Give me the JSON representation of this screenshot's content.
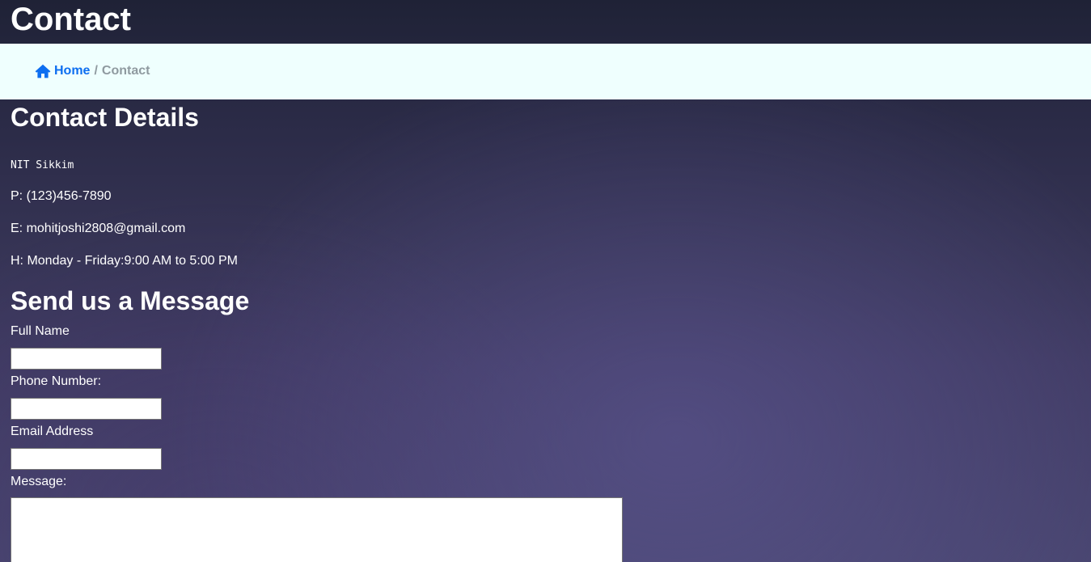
{
  "header": {
    "title": "Contact"
  },
  "breadcrumb": {
    "home_label": "Home",
    "separator": "/",
    "current": "Contact",
    "home_icon": "home-icon"
  },
  "details": {
    "title": "Contact Details",
    "institution": "NIT Sikkim",
    "phone": "P: (123)456-7890",
    "email": "E: mohitjoshi2808@gmail.com",
    "hours": "H: Monday - Friday:9:00 AM to 5:00 PM"
  },
  "form": {
    "title": "Send us a Message",
    "full_name_label": "Full Name",
    "full_name_value": "",
    "phone_label": "Phone Number:",
    "phone_value": "",
    "email_label": "Email Address",
    "email_value": "",
    "message_label": "Message:",
    "message_value": ""
  },
  "colors": {
    "breadcrumb_bg": "#effffe",
    "link": "#0d6ef0",
    "muted": "#8f9aa0",
    "text": "#ffffff"
  }
}
